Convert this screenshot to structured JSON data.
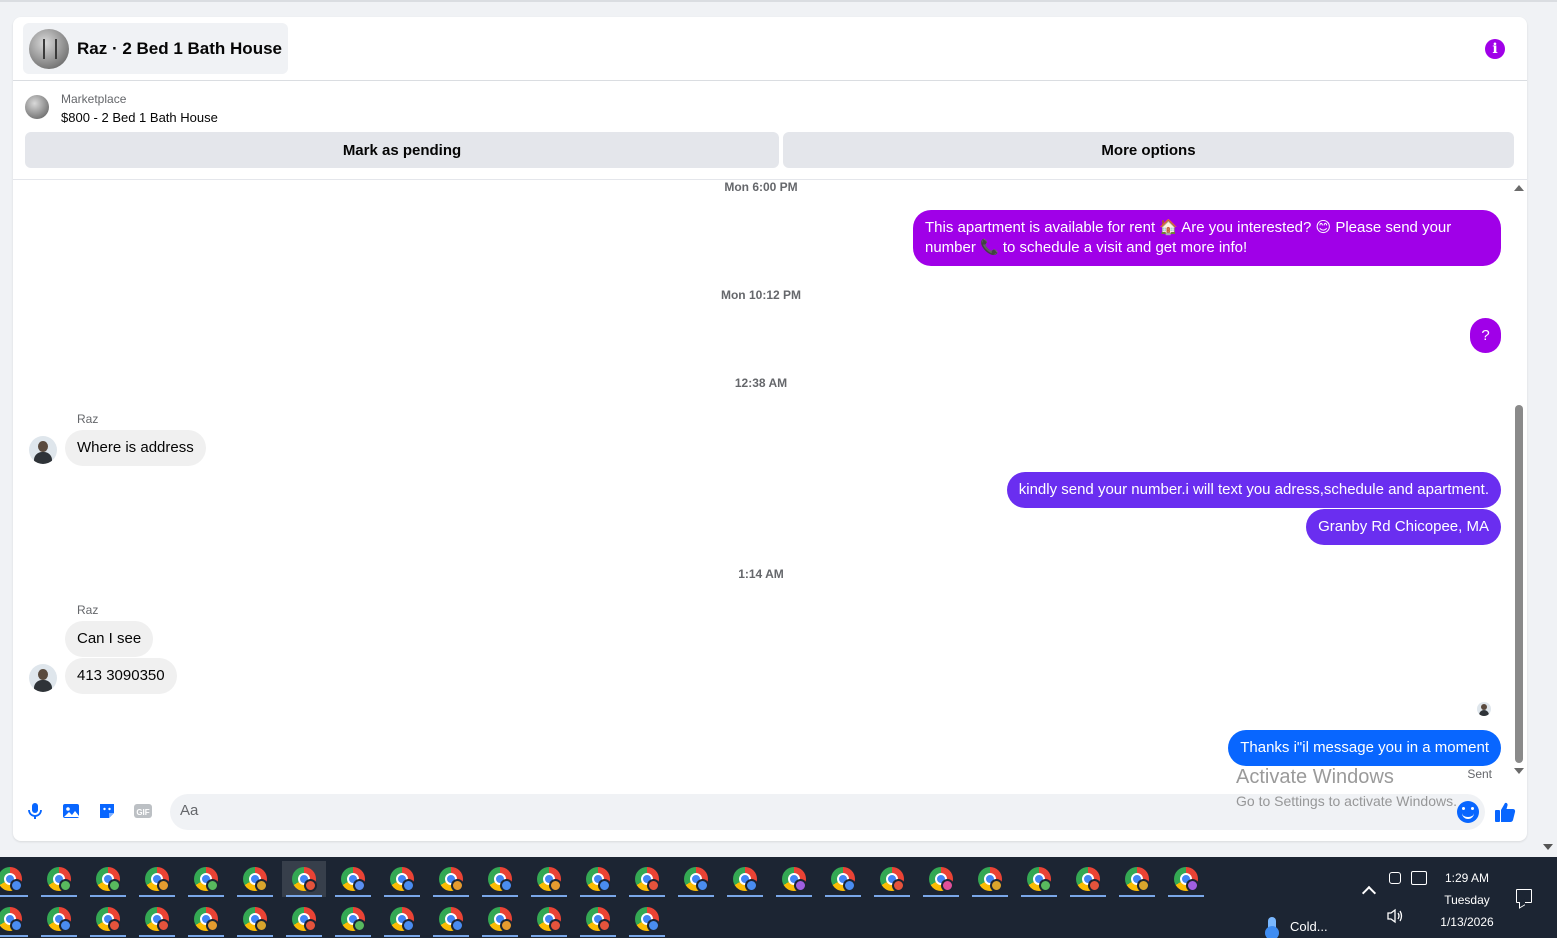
{
  "header": {
    "title": "Raz · 2 Bed 1 Bath House"
  },
  "listing": {
    "kicker": "Marketplace",
    "title": "$800 - 2 Bed 1 Bath House"
  },
  "actions": {
    "mark_pending": "Mark as pending",
    "more_options": "More options"
  },
  "thread": {
    "timestamps": [
      "Mon 6:00 PM",
      "Mon 10:12 PM",
      "12:38 AM",
      "1:14 AM"
    ],
    "messages": [
      {
        "from": "me",
        "text": "This apartment is available for rent 🏠 Are you interested? 😊 Please send your number 📞 to schedule a visit and get more info!"
      },
      {
        "from": "me",
        "text": "?"
      },
      {
        "from": "Raz",
        "sender_label": "Raz",
        "text": "Where is address"
      },
      {
        "from": "me",
        "text": "kindly send your number.i will text you adress,schedule and apartment."
      },
      {
        "from": "me",
        "text": "Granby Rd Chicopee, MA"
      },
      {
        "from": "Raz",
        "sender_label": "Raz",
        "text": "Can I see"
      },
      {
        "from": "Raz",
        "text": "413 3090350"
      },
      {
        "from": "me",
        "text": "Thanks i\"il message you in a moment"
      }
    ],
    "status": "Sent"
  },
  "composer": {
    "placeholder": "Aa",
    "icons": [
      "microphone-icon",
      "photo-icon",
      "sticker-icon",
      "gif-icon",
      "emoji-icon",
      "thumbs-up-icon"
    ],
    "gif_label": "GIF"
  },
  "watermark": {
    "line1": "Activate Windows",
    "line2": "Go to Settings to activate Windows."
  },
  "taskbar": {
    "weather": "Cold...",
    "time": "1:29 AM",
    "day": "Tuesday",
    "date": "1/13/2026",
    "profile_colors_row1": [
      "#4a8cf0",
      "#58b85e",
      "#58b85e",
      "#e59b2f",
      "#58b85e",
      "#d9a42c",
      "#e5533c",
      "#5b8ff0",
      "#4a8cf0",
      "#e59b2f",
      "#4a8cf0",
      "#e59b2f",
      "#4a8cf0",
      "#e5533c",
      "#4a8cf0",
      "#4a8cf0",
      "#a05fe0",
      "#4a8cf0",
      "#e5533c",
      "#e0509a",
      "#d9a42c",
      "#58b85e",
      "#e5533c",
      "#d9a42c",
      "#a05fe0"
    ],
    "profile_colors_row2": [
      "#4a8cf0",
      "#4a8cf0",
      "#e5533c",
      "#e5533c",
      "#e59b2f",
      "#d9a42c",
      "#e5533c",
      "#58b85e",
      "#4a8cf0",
      "#4a8cf0",
      "#e59b2f",
      "#e5533c",
      "#e5533c",
      "#4a8cf0"
    ]
  },
  "colors": {
    "accent_purple": "#a000e8",
    "accent_violet": "#6a2ef0",
    "accent_blue": "#0866ff"
  }
}
